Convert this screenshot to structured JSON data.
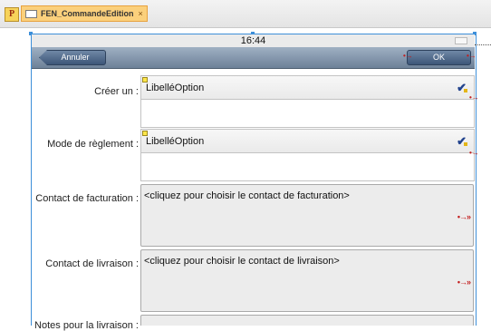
{
  "app": {
    "logo_letter": "P"
  },
  "tab": {
    "title": "FEN_CommandeEdition",
    "close": "×"
  },
  "status": {
    "time": "16:44"
  },
  "nav": {
    "back_label": "Annuler",
    "ok_label": "OK"
  },
  "form": {
    "rows": [
      {
        "label": "Créer un :",
        "value": "LibelléOption"
      },
      {
        "label": "Mode de règlement :",
        "value": "LibelléOption"
      },
      {
        "label": "Contact de facturation :",
        "value": "<cliquez pour choisir le contact de facturation>"
      },
      {
        "label": "Contact de livraison :",
        "value": "<cliquez pour choisir le contact de livraison>"
      },
      {
        "label": "Notes pour la livraison :",
        "value": ""
      }
    ]
  },
  "colors": {
    "selection_blue": "#3d8fd9",
    "tab_orange": "#fbd07c",
    "navbar": "#6d8198",
    "marker_red": "#c31e1e"
  }
}
